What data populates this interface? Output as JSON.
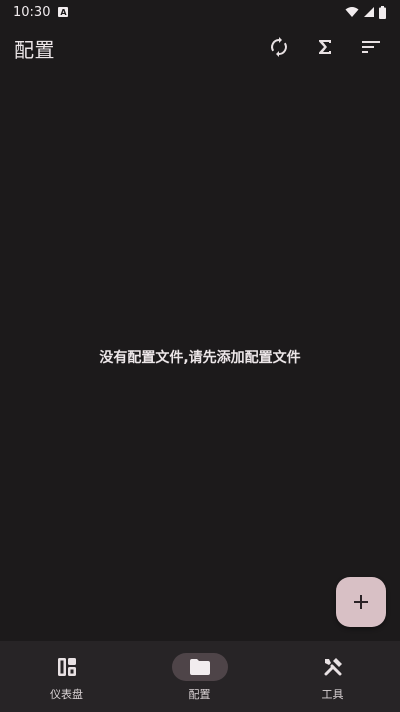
{
  "status_bar": {
    "time": "10:30",
    "notification_badge": "A"
  },
  "app_bar": {
    "title": "配置",
    "actions": [
      {
        "icon": "sync-icon"
      },
      {
        "icon": "sigma-icon"
      },
      {
        "icon": "sort-icon"
      }
    ]
  },
  "main": {
    "empty_message": "没有配置文件,请先添加配置文件"
  },
  "fab": {
    "icon": "plus-icon"
  },
  "bottom_nav": {
    "items": [
      {
        "label": "仪表盘",
        "icon": "dashboard-icon",
        "active": false
      },
      {
        "label": "配置",
        "icon": "folder-icon",
        "active": true
      },
      {
        "label": "工具",
        "icon": "tools-icon",
        "active": false
      }
    ]
  },
  "colors": {
    "background": "#1c1a1b",
    "fab": "#d8c0c5",
    "nav_background": "#272426",
    "nav_active_pill": "#4e4448"
  }
}
